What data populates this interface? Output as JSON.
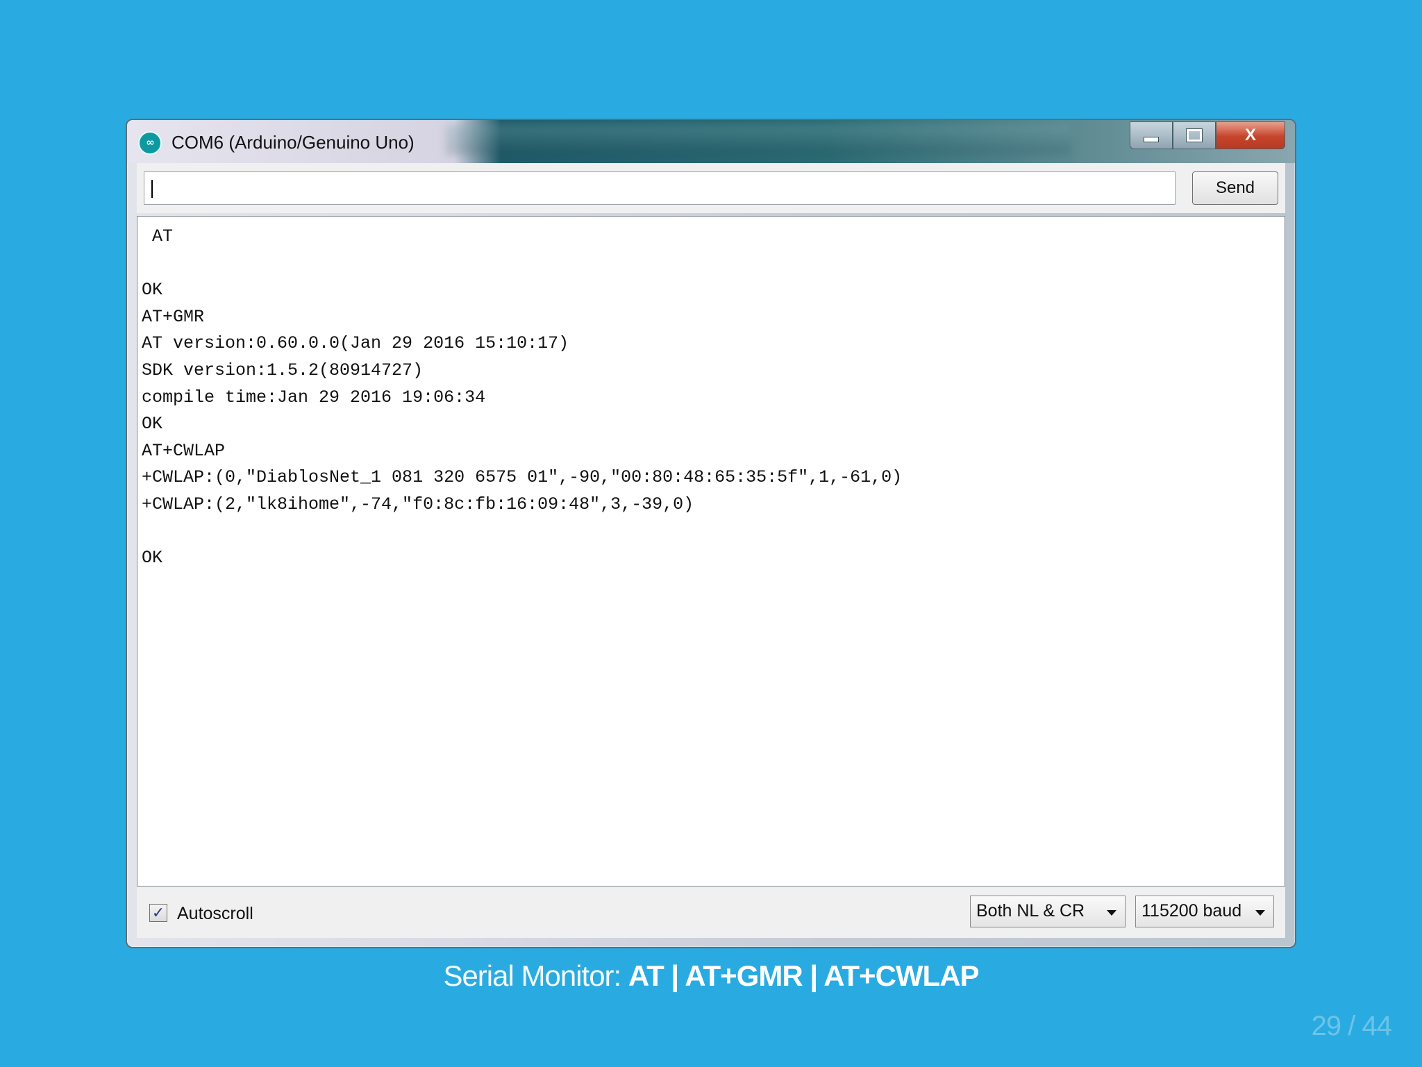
{
  "window": {
    "title": "COM6 (Arduino/Genuino Uno)",
    "icon": "arduino-infinity-icon",
    "minimize_icon": "minimize-icon",
    "maximize_icon": "maximize-icon",
    "close_glyph": "X"
  },
  "input": {
    "value": "",
    "send_label": "Send"
  },
  "output": {
    "lines": [
      " AT",
      "",
      "OK",
      "AT+GMR",
      "AT version:0.60.0.0(Jan 29 2016 15:10:17)",
      "SDK version:1.5.2(80914727)",
      "compile time:Jan 29 2016 19:06:34",
      "OK",
      "AT+CWLAP",
      "+CWLAP:(0,\"DiablosNet_1 081 320 6575 01\",-90,\"00:80:48:65:35:5f\",1,-61,0)",
      "+CWLAP:(2,\"lk8ihome\",-74,\"f0:8c:fb:16:09:48\",3,-39,0)",
      "",
      "OK"
    ]
  },
  "status": {
    "autoscroll_label": "Autoscroll",
    "autoscroll_checked": true,
    "check_glyph": "✓",
    "line_ending": "Both NL & CR",
    "baud": "115200 baud"
  },
  "caption": {
    "prefix": "Serial Monitor: ",
    "commands": "AT | AT+GMR | AT+CWLAP"
  },
  "slide": {
    "page": "29 / 44"
  }
}
